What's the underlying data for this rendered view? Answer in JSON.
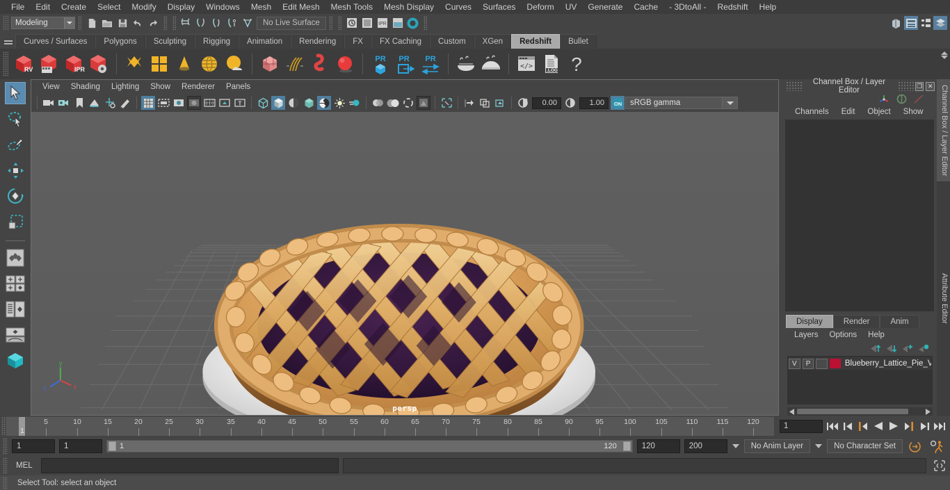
{
  "menubar": {
    "items": [
      "File",
      "Edit",
      "Create",
      "Select",
      "Modify",
      "Display",
      "Windows",
      "Mesh",
      "Edit Mesh",
      "Mesh Tools",
      "Mesh Display",
      "Curves",
      "Surfaces",
      "Deform",
      "UV",
      "Generate",
      "Cache",
      "- 3DtoAll -",
      "Redshift",
      "Help"
    ]
  },
  "statusline": {
    "mode": "Modeling",
    "live_surface": "No Live Surface",
    "icons": [
      "new-scene-icon",
      "open-scene-icon",
      "save-scene-icon",
      "undo-icon",
      "redo-icon",
      "select-hierarchy-icon",
      "select-object-icon",
      "snap-grid-icon",
      "snap-curve-icon",
      "snap-point-icon",
      "snap-projected-center-icon",
      "snap-view-plane-icon",
      "construction-history-icon",
      "render-view-icon",
      "ipr-render-icon",
      "render-settings-icon",
      "show-manipulator-icon"
    ],
    "right_icons": [
      "modeling-toolkit-icon",
      "attribute-editor-icon",
      "tool-settings-icon",
      "channel-box-icon"
    ]
  },
  "shelf": {
    "tabs": [
      "Curves / Surfaces",
      "Polygons",
      "Sculpting",
      "Rigging",
      "Animation",
      "Rendering",
      "FX",
      "FX Caching",
      "Custom",
      "XGen",
      "Redshift",
      "Bullet"
    ],
    "selected_tab": "Redshift",
    "buttons": [
      {
        "name": "redshift-render-view",
        "label": "RV"
      },
      {
        "name": "redshift-render-sequence",
        "label": ""
      },
      {
        "name": "redshift-ipr",
        "label": "IPR"
      },
      {
        "name": "redshift-render-settings",
        "label": ""
      },
      {
        "name": "redshift-material-diamond",
        "label": ""
      },
      {
        "name": "redshift-material-grid",
        "label": ""
      },
      {
        "name": "redshift-light-cone",
        "label": ""
      },
      {
        "name": "redshift-dome-light",
        "label": ""
      },
      {
        "name": "redshift-environment",
        "label": ""
      },
      {
        "name": "redshift-proxy-cube",
        "label": ""
      },
      {
        "name": "redshift-hair",
        "label": ""
      },
      {
        "name": "redshift-volume",
        "label": ""
      },
      {
        "name": "redshift-sphere",
        "label": ""
      },
      {
        "name": "redshift-pr-object",
        "label": "PR"
      },
      {
        "name": "redshift-pr-export",
        "label": "PR"
      },
      {
        "name": "redshift-pr-transfer",
        "label": "PR"
      },
      {
        "name": "redshift-bake-1",
        "label": ""
      },
      {
        "name": "redshift-bake-2",
        "label": ""
      },
      {
        "name": "redshift-script-editor",
        "label": ""
      },
      {
        "name": "redshift-log",
        "label": ".LOG"
      },
      {
        "name": "redshift-help",
        "label": "?"
      }
    ]
  },
  "toolbox": {
    "items": [
      {
        "name": "select-tool",
        "selected": true
      },
      {
        "name": "lasso-select-tool",
        "selected": false
      },
      {
        "name": "paint-select-tool",
        "selected": false
      },
      {
        "name": "move-tool",
        "selected": false
      },
      {
        "name": "rotate-tool",
        "selected": false
      },
      {
        "name": "scale-tool",
        "selected": false
      },
      {
        "name": "last-tool-used",
        "selected": false
      },
      {
        "name": "quad-view-layout",
        "selected": false
      },
      {
        "name": "outliner-persp-layout",
        "selected": false
      },
      {
        "name": "persp-graph-layout",
        "selected": false
      },
      {
        "name": "workspace-selector",
        "selected": false
      }
    ]
  },
  "viewport": {
    "menus": [
      "View",
      "Shading",
      "Lighting",
      "Show",
      "Renderer",
      "Panels"
    ],
    "camera_label": "persp",
    "exposure": "0.00",
    "gamma": "1.00",
    "color_space": "sRGB gamma",
    "toolbar_icons": [
      "select-camera-icon",
      "camera-attributes-icon",
      "bookmark-icon",
      "image-plane-icon",
      "2d-pan-zoom-icon",
      "grease-pencil-icon",
      "grid-icon",
      "film-gate-icon",
      "resolution-gate-icon",
      "gate-mask-icon",
      "field-chart-icon",
      "safe-action-icon",
      "safe-title-icon",
      "wireframe-icon",
      "smooth-shade-icon",
      "shade-hwtex-icon",
      "use-all-lights-icon",
      "shadows-icon",
      "screen-space-ao-icon",
      "motion-blur-icon",
      "multisample-icon",
      "depth-of-field-icon",
      "isolate-select-icon",
      "xray-icon",
      "xray-joints-icon",
      "xray-active-components-icon",
      "exposure-icon",
      "gamma-icon",
      "color-management-icon"
    ],
    "subject": "Blueberry lattice pie on a white plate, 3D rendered model on a grid floor"
  },
  "channel_box": {
    "title": "Channel Box / Layer Editor",
    "menus": [
      "Channels",
      "Edit",
      "Object",
      "Show"
    ],
    "restore_glyph": "❐",
    "close_glyph": "✕",
    "vertical_tabs": [
      "Channel Box / Layer Editor",
      "Attribute Editor"
    ]
  },
  "layer_editor": {
    "tabs": [
      "Display",
      "Render",
      "Anim"
    ],
    "selected_tab": "Display",
    "menus": [
      "Layers",
      "Options",
      "Help"
    ],
    "arrow_icons": [
      "move-layer-up-icon",
      "move-layer-down-icon",
      "new-layer-icon",
      "new-layer-from-selected-icon"
    ],
    "layers": [
      {
        "visibility": "V",
        "playback": "P",
        "shading": "",
        "color": "#bb1133",
        "name": "Blueberry_Lattice_Pie_V"
      }
    ]
  },
  "timeline": {
    "ticks": [
      5,
      10,
      15,
      20,
      25,
      30,
      35,
      40,
      45,
      50,
      55,
      60,
      65,
      70,
      75,
      80,
      85,
      90,
      95,
      100,
      105,
      110,
      115,
      120
    ],
    "current_frame": "1",
    "frame_field": "1",
    "playback_buttons": [
      "go-to-start-icon",
      "step-back-keyframe-icon",
      "step-back-frame-icon",
      "play-backwards-icon",
      "play-forwards-icon",
      "step-forward-frame-icon",
      "step-forward-keyframe-icon",
      "go-to-end-icon"
    ]
  },
  "range_bar": {
    "anim_start": "1",
    "range_start": "1",
    "slider_min_label": "1",
    "slider_max_label": "120",
    "range_end": "120",
    "anim_end": "200",
    "anim_layer": "No Anim Layer",
    "character_set": "No Character Set",
    "icons": [
      "auto-keyframe-icon",
      "animation-preferences-icon"
    ]
  },
  "command_line": {
    "language": "MEL",
    "input_value": "",
    "output_value": "",
    "expand_icon": "script-editor-icon"
  },
  "status_bar": {
    "message": "Select Tool: select an object"
  },
  "colors": {
    "bg": "#444444",
    "panel": "#3c3c3c",
    "accent_blue": "#5a8bb0",
    "shelf_selected": "#a9a9a9",
    "layer_color": "#bb1133",
    "viewport_bg": "#5e5e5e"
  }
}
